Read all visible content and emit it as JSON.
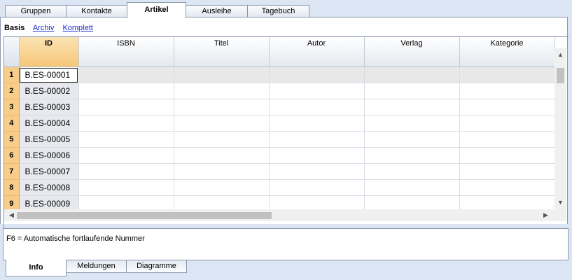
{
  "top_tabs": [
    "Gruppen",
    "Kontakte",
    "Artikel",
    "Ausleihe",
    "Tagebuch"
  ],
  "active_top_tab": "Artikel",
  "views": {
    "active": "Basis",
    "links": [
      "Archiv",
      "Komplett"
    ]
  },
  "columns": [
    "ID",
    "ISBN",
    "Titel",
    "Autor",
    "Verlag",
    "Kategorie"
  ],
  "rows": [
    {
      "num": "1",
      "id": "B.ES-00001"
    },
    {
      "num": "2",
      "id": "B.ES-00002"
    },
    {
      "num": "3",
      "id": "B.ES-00003"
    },
    {
      "num": "4",
      "id": "B.ES-00004"
    },
    {
      "num": "5",
      "id": "B.ES-00005"
    },
    {
      "num": "6",
      "id": "B.ES-00006"
    },
    {
      "num": "7",
      "id": "B.ES-00007"
    },
    {
      "num": "8",
      "id": "B.ES-00008"
    },
    {
      "num": "9",
      "id": "B.ES-00009"
    }
  ],
  "info_text": "F6 = Automatische fortlaufende Nummer",
  "bottom_tabs": [
    "Info",
    "Meldungen",
    "Diagramme"
  ],
  "active_bottom_tab": "Info",
  "icons": {
    "scroll_up": "▲",
    "scroll_down": "▼",
    "scroll_left": "◀",
    "scroll_right": "▶"
  }
}
